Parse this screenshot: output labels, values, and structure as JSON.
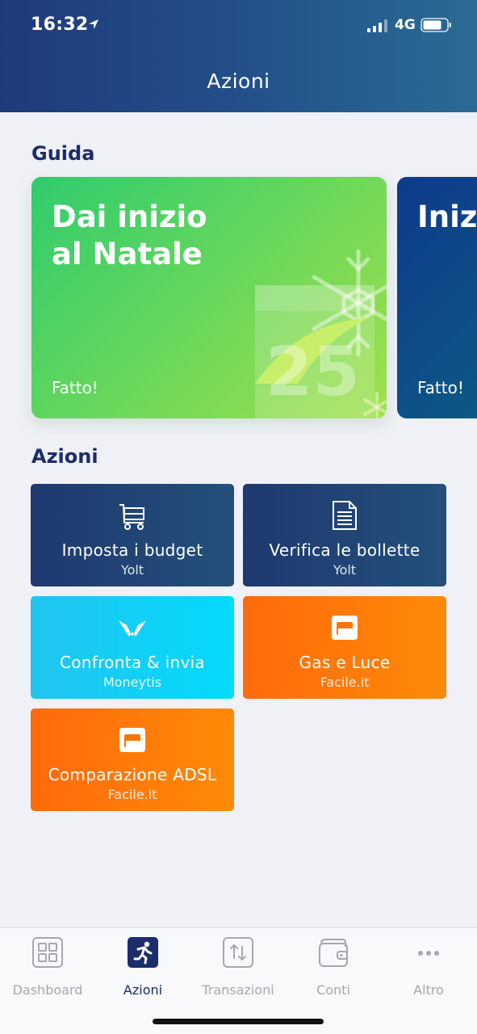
{
  "status_bar": {
    "time": "16:32",
    "network": "4G"
  },
  "header": {
    "title": "Azioni"
  },
  "guide": {
    "title": "Guida",
    "cards": [
      {
        "headline": "Dai inizio\nal Natale",
        "status": "Fatto!",
        "art_number": "25"
      },
      {
        "headline": "Iniz",
        "status": "Fatto!"
      }
    ]
  },
  "actions": {
    "title": "Azioni",
    "tiles": [
      {
        "label": "Imposta i budget",
        "provider": "Yolt",
        "icon": "cart-icon",
        "color": "#1e3970"
      },
      {
        "label": "Verifica le bollette",
        "provider": "Yolt",
        "icon": "document-icon",
        "color": "#1e3970"
      },
      {
        "label": "Confronta & invia",
        "provider": "Moneytis",
        "icon": "moneytis-logo-icon",
        "color": "#22c4ef"
      },
      {
        "label": "Gas e Luce",
        "provider": "Facile.it",
        "icon": "facile-logo-icon",
        "color": "#ff6a0a"
      },
      {
        "label": "Comparazione ADSL",
        "provider": "Facile.it",
        "icon": "facile-logo-icon",
        "color": "#ff6a0a"
      }
    ]
  },
  "tab_bar": {
    "tabs": [
      {
        "label": "Dashboard",
        "icon": "dashboard-icon",
        "active": false
      },
      {
        "label": "Azioni",
        "icon": "running-person-icon",
        "active": true
      },
      {
        "label": "Transazioni",
        "icon": "transactions-icon",
        "active": false
      },
      {
        "label": "Conti",
        "icon": "wallet-icon",
        "active": false
      },
      {
        "label": "Altro",
        "icon": "more-icon",
        "active": false
      }
    ]
  }
}
